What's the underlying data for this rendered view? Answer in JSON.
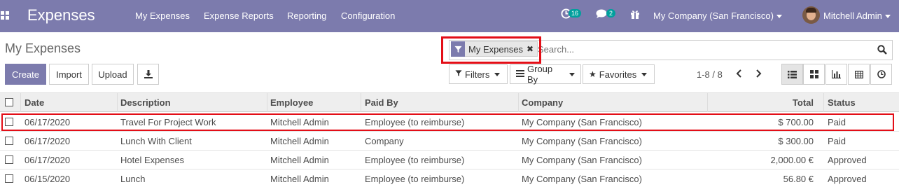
{
  "navbar": {
    "app_title": "Expenses",
    "menu": [
      "My Expenses",
      "Expense Reports",
      "Reporting",
      "Configuration"
    ],
    "activity_count": "16",
    "message_count": "2",
    "company": "My Company (San Francisco)",
    "user": "Mitchell Admin",
    "color": "#7c7bad"
  },
  "control": {
    "page_title": "My Expenses",
    "facet_label": "My Expenses",
    "search_placeholder": "Search...",
    "create_label": "Create",
    "import_label": "Import",
    "upload_label": "Upload",
    "filters_label": "Filters",
    "groupby_label": "Group By",
    "favorites_label": "Favorites",
    "pager": "1-8 / 8"
  },
  "table": {
    "headers": [
      "Date",
      "Description",
      "Employee",
      "Paid By",
      "Company",
      "Total",
      "Status"
    ],
    "rows": [
      [
        "06/17/2020",
        "Travel For Project Work",
        "Mitchell Admin",
        "Employee (to reimburse)",
        "My Company (San Francisco)",
        "$ 700.00",
        "Paid"
      ],
      [
        "06/17/2020",
        "Lunch With Client",
        "Mitchell Admin",
        "Company",
        "My Company (San Francisco)",
        "$ 300.00",
        "Paid"
      ],
      [
        "06/17/2020",
        "Hotel Expenses",
        "Mitchell Admin",
        "Employee (to reimburse)",
        "My Company (San Francisco)",
        "2,000.00 €",
        "Approved"
      ],
      [
        "06/15/2020",
        "Lunch",
        "Mitchell Admin",
        "Employee (to reimburse)",
        "My Company (San Francisco)",
        "56.80 €",
        "Approved"
      ]
    ]
  },
  "icons": {
    "apps": "apps-grid-icon",
    "activity": "clock-icon",
    "messages": "chat-icon",
    "gift": "gift-icon",
    "filter": "funnel-icon",
    "search": "magnifier-icon",
    "download": "download-icon",
    "views": [
      "list-view-icon",
      "kanban-view-icon",
      "graph-view-icon",
      "pivot-view-icon",
      "activity-view-icon"
    ]
  },
  "highlight_color": "#e30e17"
}
